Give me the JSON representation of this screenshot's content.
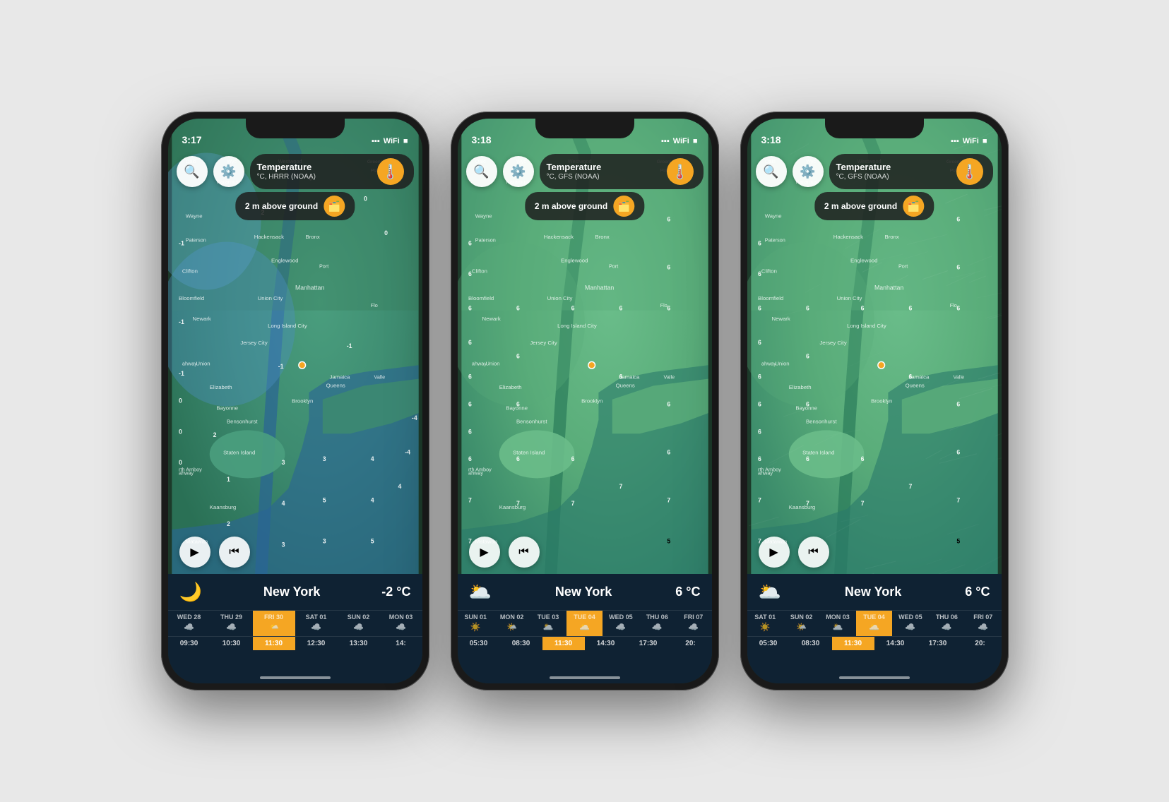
{
  "phones": [
    {
      "id": "phone1",
      "time": "3:17",
      "model": "HRRR (NOAA)",
      "mapModel": "°C, HRRR (NOAA)",
      "tempLabel": "Temperature",
      "ground": "2 m above ground",
      "cityName": "New York",
      "cityTemp": "-2 °C",
      "cityIcon": "🌙",
      "calDays": [
        {
          "name": "WED",
          "num": "28",
          "icon": "☁️",
          "active": false
        },
        {
          "name": "THU",
          "num": "29",
          "icon": "☁️",
          "active": false
        },
        {
          "name": "FRI",
          "num": "30",
          "icon": "🌤️",
          "active": true
        },
        {
          "name": "SAT",
          "num": "01",
          "icon": "☁️",
          "active": false
        },
        {
          "name": "SUN",
          "num": "02",
          "icon": "☁️",
          "active": false
        },
        {
          "name": "MON",
          "num": "03",
          "icon": "☁️",
          "active": false
        }
      ],
      "times": [
        "09:30",
        "10:30",
        "11:30",
        "12:30",
        "13:30",
        "14:"
      ],
      "activeTime": 2,
      "mapVariant": "blue-green"
    },
    {
      "id": "phone2",
      "time": "3:18",
      "model": "GFS (NOAA)",
      "mapModel": "°C, GFS (NOAA)",
      "tempLabel": "Temperature",
      "ground": "2 m above ground",
      "cityName": "New York",
      "cityTemp": "6 °C",
      "cityIcon": "🌥️",
      "calDays": [
        {
          "name": "SUN",
          "num": "01",
          "icon": "☀️",
          "active": false
        },
        {
          "name": "MON",
          "num": "02",
          "icon": "🌤️",
          "active": false
        },
        {
          "name": "TUE",
          "num": "03",
          "icon": "🌥️",
          "active": false
        },
        {
          "name": "TUE",
          "num": "04",
          "icon": "🌥️",
          "active": true
        },
        {
          "name": "WED",
          "num": "05",
          "icon": "☁️",
          "active": false
        },
        {
          "name": "THU",
          "num": "06",
          "icon": "☁️",
          "active": false
        },
        {
          "name": "FRI",
          "num": "07",
          "icon": "☁️",
          "active": false
        }
      ],
      "times": [
        "05:30",
        "08:30",
        "11:30",
        "14:30",
        "17:30",
        "20:"
      ],
      "activeTime": 2,
      "mapVariant": "green"
    },
    {
      "id": "phone3",
      "time": "3:18",
      "model": "GFS (NOAA)",
      "mapModel": "°C, GFS (NOAA)",
      "tempLabel": "Temperature",
      "ground": "2 m above ground",
      "cityName": "New York",
      "cityTemp": "6 °C",
      "cityIcon": "🌥️",
      "calDays": [
        {
          "name": "SAT",
          "num": "01",
          "icon": "☀️",
          "active": false
        },
        {
          "name": "SUN",
          "num": "02",
          "icon": "🌤️",
          "active": false
        },
        {
          "name": "MON",
          "num": "03",
          "icon": "🌥️",
          "active": false
        },
        {
          "name": "TUE",
          "num": "04",
          "icon": "🌥️",
          "active": true
        },
        {
          "name": "WED",
          "num": "05",
          "icon": "☁️",
          "active": false
        },
        {
          "name": "THU",
          "num": "06",
          "icon": "☁️",
          "active": false
        },
        {
          "name": "FRI",
          "num": "07",
          "icon": "☁️",
          "active": false
        }
      ],
      "times": [
        "05:30",
        "08:30",
        "11:30",
        "14:30",
        "17:30",
        "20:"
      ],
      "activeTime": 2,
      "mapVariant": "green-wind"
    }
  ],
  "icons": {
    "search": "🔍",
    "gear": "⚙️",
    "thermometer": "🌡️",
    "layers": "🗂️",
    "play": "▶",
    "skip": "⏮"
  }
}
